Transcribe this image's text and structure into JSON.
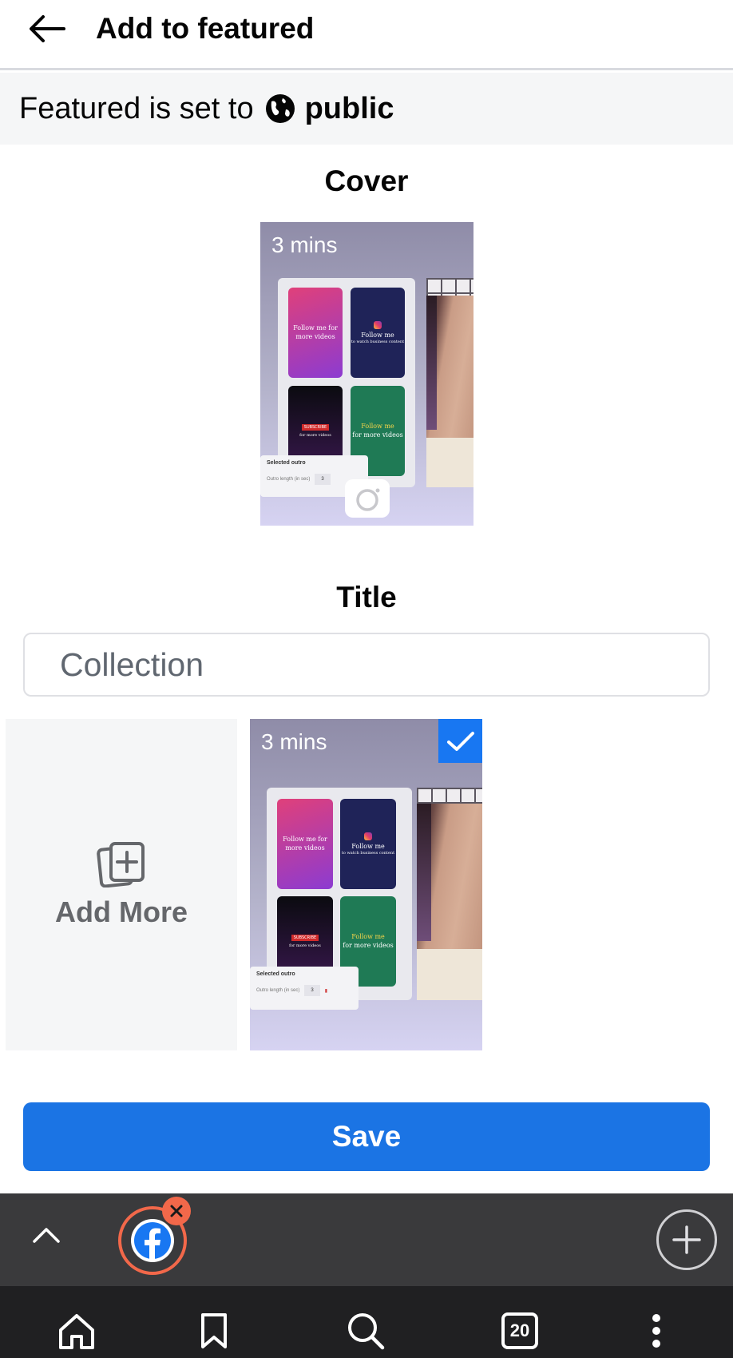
{
  "header": {
    "title": "Add to featured",
    "back_icon": "arrow-left-icon"
  },
  "privacy": {
    "prefix": "Featured is set to",
    "value": "public",
    "icon": "globe-icon"
  },
  "cover": {
    "label": "Cover",
    "duration": "3 mins",
    "camera_icon": "camera-icon"
  },
  "title_section": {
    "label": "Title",
    "input_placeholder": "Collection"
  },
  "media": {
    "add_more_label": "Add More",
    "add_more_icon": "add-photo-icon",
    "item_duration": "3 mins",
    "item_selected": true,
    "check_icon": "checkmark-icon"
  },
  "thumbnail_content": {
    "card1": "Follow me for more videos",
    "card2_title": "Follow me",
    "card2_sub": "to watch business content",
    "card3_tag": "SUBSCRIBE",
    "card3_sub": "for more videos",
    "card4_hl": "Follow me",
    "card4_rest": "for more videos",
    "outro_title": "Selected outro",
    "outro_label": "Outro length (in sec)",
    "outro_value": "3"
  },
  "save": {
    "label": "Save"
  },
  "browser": {
    "tab_count": "20",
    "accent": "#f2684a",
    "icons": [
      "chevron-up-icon",
      "facebook-icon",
      "close-icon",
      "plus-icon",
      "home-icon",
      "bookmark-icon",
      "search-icon",
      "tabs-icon",
      "more-vertical-icon"
    ]
  },
  "colors": {
    "primary": "#1b74e4",
    "check": "#1877f2"
  }
}
